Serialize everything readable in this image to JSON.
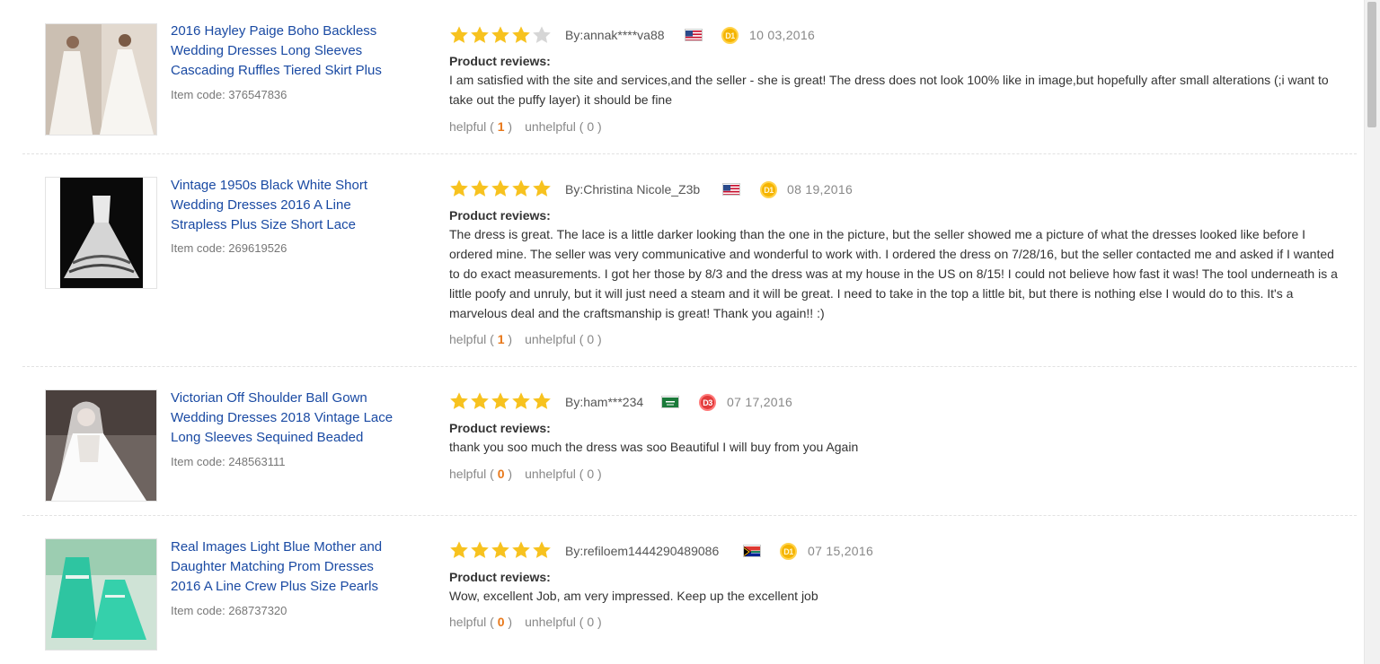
{
  "labels": {
    "product_reviews": "Product reviews:",
    "helpful": "helpful",
    "unhelpful": "unhelpful",
    "paren_open": "( ",
    "paren_close": " )"
  },
  "colors": {
    "link": "#1a4aa3",
    "star_filled": "#f7c21f",
    "star_empty": "#d6d6d6",
    "count_highlight": "#e8781a"
  },
  "reviews": [
    {
      "product_title": "2016 Hayley Paige Boho Backless Wedding Dresses Long Sleeves Cascading Ruffles Tiered Skirt Plus",
      "item_code": "Item code: 376547836",
      "rating": 4,
      "rating_max": 5,
      "reviewer": "By:annak****va88",
      "flag": "us-flag-icon",
      "badge": "D1",
      "badge_color": "gold",
      "date": "10 03,2016",
      "text": "I am satisfied with the site and services,and the seller - she is great! The dress does not look 100% like in image,but hopefully after small alterations (;i want to take out the puffy layer) it should be fine",
      "helpful_count": "1",
      "unhelpful_count": "0"
    },
    {
      "product_title": "Vintage 1950s Black White Short Wedding Dresses 2016 A Line Strapless Plus Size Short Lace",
      "item_code": "Item code: 269619526",
      "rating": 5,
      "rating_max": 5,
      "reviewer": "By:Christina Nicole_Z3b",
      "flag": "us-flag-icon",
      "badge": "D1",
      "badge_color": "gold",
      "date": "08 19,2016",
      "text": "The dress is great. The lace is a little darker looking than the one in the picture, but the seller showed me a picture of what the dresses looked like before I ordered mine. The seller was very communicative and wonderful to work with. I ordered the dress on 7/28/16, but the seller contacted me and asked if I wanted to do exact measurements. I got her those by 8/3 and the dress was at my house in the US on 8/15! I could not believe how fast it was! The tool underneath is a little poofy and unruly, but it will just need a steam and it will be great. I need to take in the top a little bit, but there is nothing else I would do to this. It's a marvelous deal and the craftsmanship is great! Thank you again!! :)",
      "helpful_count": "1",
      "unhelpful_count": "0"
    },
    {
      "product_title": "Victorian Off Shoulder Ball Gown Wedding Dresses 2018 Vintage Lace Long Sleeves Sequined Beaded",
      "item_code": "Item code: 248563111",
      "rating": 5,
      "rating_max": 5,
      "reviewer": "By:ham***234",
      "flag": "saudi-flag-icon",
      "badge": "D3",
      "badge_color": "red",
      "date": "07 17,2016",
      "text": "thank you soo much the dress was soo Beautiful I will buy from you Again",
      "helpful_count": "0",
      "unhelpful_count": "0"
    },
    {
      "product_title": "Real Images Light Blue Mother and Daughter Matching Prom Dresses 2016 A Line Crew Plus Size Pearls",
      "item_code": "Item code: 268737320",
      "rating": 5,
      "rating_max": 5,
      "reviewer": "By:refiloem1444290489086",
      "flag": "south-africa-flag-icon",
      "badge": "D1",
      "badge_color": "gold",
      "date": "07 15,2016",
      "text": "Wow, excellent Job, am very impressed. Keep up the excellent job",
      "helpful_count": "0",
      "unhelpful_count": "0"
    }
  ]
}
